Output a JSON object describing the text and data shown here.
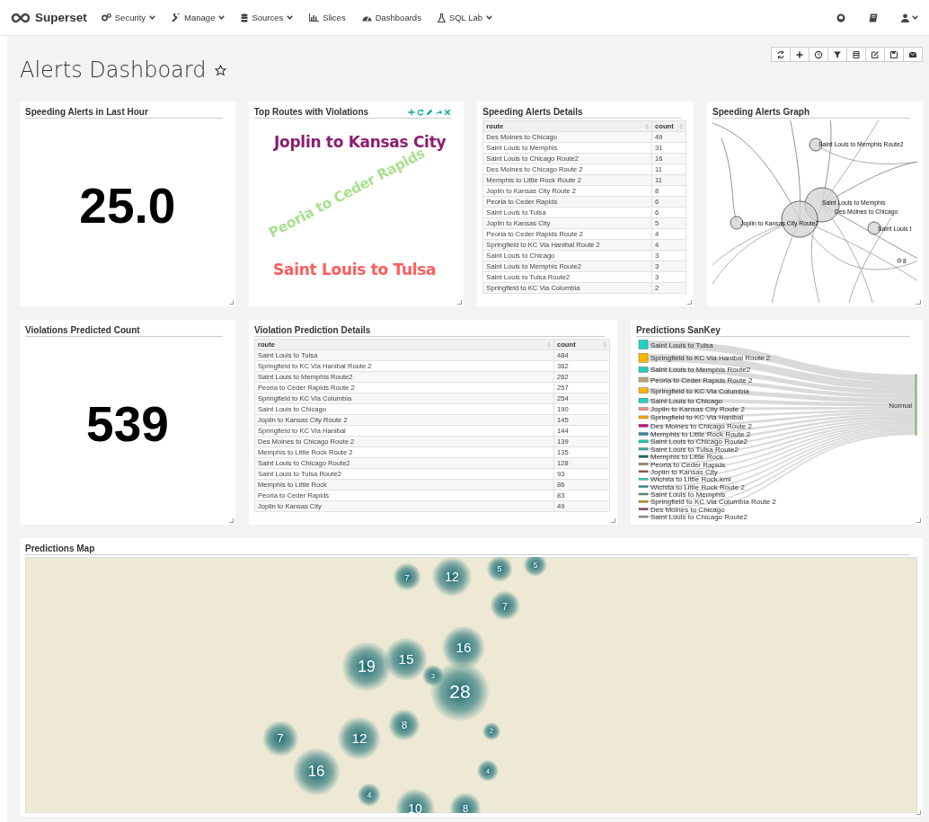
{
  "navbar": {
    "brand": "Superset",
    "menus": [
      {
        "label": "Security",
        "dropdown": true
      },
      {
        "label": "Manage",
        "dropdown": true
      },
      {
        "label": "Sources",
        "dropdown": true
      },
      {
        "label": "Slices",
        "dropdown": false
      },
      {
        "label": "Dashboards",
        "dropdown": false
      },
      {
        "label": "SQL Lab",
        "dropdown": true
      }
    ]
  },
  "dashboard": {
    "title": "Alerts Dashboard",
    "favorite": false
  },
  "slices": [
    {
      "kind": "big_number",
      "title": "Speeding Alerts in Last Hour",
      "show_controls": false,
      "value": "25.0"
    },
    {
      "kind": "word_cloud",
      "title": "Top Routes with Violations",
      "show_controls": true,
      "words": [
        {
          "text": "Joplin to Kansas City",
          "color": "#8b1d6e"
        },
        {
          "text": "Peoria to Ceder Rapids",
          "color": "#a9e08f"
        },
        {
          "text": "Saint Louis to Tulsa",
          "color": "#ff5c5c"
        }
      ]
    },
    {
      "kind": "table",
      "title": "Speeding Alerts Details",
      "show_controls": false,
      "columns": [
        "route",
        "count"
      ],
      "rows": [
        [
          "Des Moines to Chicago",
          "49"
        ],
        [
          "Saint Louis to Memphis",
          "31"
        ],
        [
          "Saint Louis to Chicago Route2",
          "16"
        ],
        [
          "Des Moines to Chicago Route 2",
          "11"
        ],
        [
          "Memphis to Little Rock Route 2",
          "11"
        ],
        [
          "Joplin to Kansas City Route 2",
          "8"
        ],
        [
          "Peoria to Ceder Rapids",
          "6"
        ],
        [
          "Saint Louis to Tulsa",
          "6"
        ],
        [
          "Joplin to Kansas City",
          "5"
        ],
        [
          "Peoria to Ceder Rapids Route 2",
          "4"
        ],
        [
          "Springfield to KC Via Hanibal Route 2",
          "4"
        ],
        [
          "Saint Louis to Chicago",
          "3"
        ],
        [
          "Saint Louis to Memphis Route2",
          "3"
        ],
        [
          "Saint Louis to Tulsa Route2",
          "3"
        ],
        [
          "Springfield to KC Via Columbia",
          "2"
        ]
      ]
    },
    {
      "kind": "graph",
      "title": "Speeding Alerts Graph",
      "show_controls": false,
      "node_labels": [
        "Saint Louis to Memphis Route2",
        "Saint Louis to Memphis",
        "Des Moines to Chicago",
        "Joplin to Kansas City Route2",
        "Saint Louis t",
        "8"
      ]
    },
    {
      "kind": "big_number",
      "title": "Violations Predicted Count",
      "show_controls": false,
      "value": "539"
    },
    {
      "kind": "table",
      "title": "Violation Prediction Details",
      "show_controls": false,
      "columns": [
        "route",
        "count"
      ],
      "rows": [
        [
          "Saint Louis to Tulsa",
          "484"
        ],
        [
          "Springfield to KC Via Hanibal Route 2",
          "362"
        ],
        [
          "Saint Louis to Memphis Route2",
          "262"
        ],
        [
          "Peoria to Ceder Rapids Route 2",
          "257"
        ],
        [
          "Springfield to KC Via Columbia",
          "254"
        ],
        [
          "Saint Louis to Chicago",
          "190"
        ],
        [
          "Joplin to Kansas City Route 2",
          "145"
        ],
        [
          "Springfield to KC Via Hanibal",
          "144"
        ],
        [
          "Des Moines to Chicago Route 2",
          "139"
        ],
        [
          "Memphis to Little Rock Route 2",
          "135"
        ],
        [
          "Saint Louis to Chicago Route2",
          "128"
        ],
        [
          "Saint Louis to Tulsa Route2",
          "93"
        ],
        [
          "Memphis to Little Rock",
          "86"
        ],
        [
          "Peoria to Ceder Rapids",
          "83"
        ],
        [
          "Joplin to Kansas City",
          "49"
        ]
      ]
    },
    {
      "kind": "sankey",
      "title": "Predictions SanKey",
      "show_controls": false,
      "target": "Normal",
      "sources": [
        {
          "label": "Saint Louis to Tulsa",
          "color": "#1fd3c3"
        },
        {
          "label": "Springfield to KC Via Hanibal Route 2",
          "color": "#ffb400"
        },
        {
          "label": "Saint Louis to Memphis Route2",
          "color": "#20cfc0"
        },
        {
          "label": "Peoria to Ceder Rapids Route 2",
          "color": "#b8a876"
        },
        {
          "label": "Springfield to KC Via Columbia",
          "color": "#ffb400"
        },
        {
          "label": "Saint Louis to Chicago",
          "color": "#1fd3c3"
        },
        {
          "label": "Joplin to Kansas City Route 2",
          "color": "#ff8a8a"
        },
        {
          "label": "Springfield to KC Via Hanibal",
          "color": "#ffa800"
        },
        {
          "label": "Des Moines to Chicago Route 2",
          "color": "#cc0a8a"
        },
        {
          "label": "Memphis to Little Rock Route 2",
          "color": "#2a8ca8"
        },
        {
          "label": "Saint Louis to Chicago Route2",
          "color": "#22cbbb"
        },
        {
          "label": "Saint Louis to Tulsa Route2",
          "color": "#28b0a2"
        },
        {
          "label": "Memphis to Little Rock",
          "color": "#006d6d"
        },
        {
          "label": "Peoria to Ceder Rapids",
          "color": "#9c8c55"
        },
        {
          "label": "Joplin to Kansas City",
          "color": "#a0463c"
        },
        {
          "label": "Wichita to Little Rock.kml",
          "color": "#1fd3c3"
        },
        {
          "label": "Wichita to Little Rock Route 2",
          "color": "#159a8c"
        },
        {
          "label": "Saint Louis to Memphis",
          "color": "#3a9a8a"
        },
        {
          "label": "Springfield to KC Via Columbia Route 2",
          "color": "#c29000"
        },
        {
          "label": "Des Moines to Chicago",
          "color": "#8e2d6e"
        },
        {
          "label": "Saint Louis to Chicago Route2",
          "color": "#999999"
        }
      ]
    },
    {
      "kind": "map",
      "title": "Predictions Map",
      "show_controls": false,
      "clusters": [
        "7",
        "12",
        "5",
        "5",
        "7",
        "19",
        "15",
        "3",
        "16",
        "28",
        "7",
        "12",
        "8",
        "2",
        "16",
        "4",
        "4",
        "10",
        "8"
      ]
    }
  ]
}
